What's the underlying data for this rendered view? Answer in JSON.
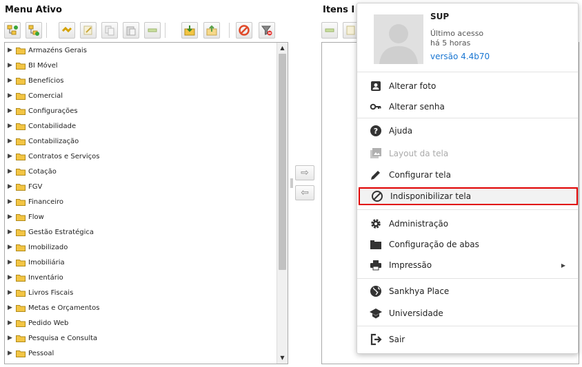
{
  "left_title": "Menu Ativo",
  "right_title": "Itens I",
  "menu_tree": [
    "Armazéns Gerais",
    "BI Móvel",
    "Benefícios",
    "Comercial",
    "Configurações",
    "Contabilidade",
    "Contabilização",
    "Contratos e Serviços",
    "Cotação",
    "FGV",
    "Financeiro",
    "Flow",
    "Gestão Estratégica",
    "Imobilizado",
    "Imobiliária",
    "Inventário",
    "Livros Fiscais",
    "Metas e Orçamentos",
    "Pedido Web",
    "Pesquisa e Consulta",
    "Pessoal"
  ],
  "user_panel": {
    "name": "SUP",
    "last_access_label": "Último acesso",
    "last_access_value": "há 5 horas",
    "version": "versão 4.4b70"
  },
  "user_menu": {
    "change_photo": "Alterar foto",
    "change_password": "Alterar senha",
    "help": "Ajuda",
    "screen_layout": "Layout da tela",
    "configure_screen": "Configurar tela",
    "disable_screen": "Indisponibilizar tela",
    "administration": "Administração",
    "tab_configuration": "Configuração de abas",
    "printing": "Impressão",
    "sankhya_place": "Sankhya Place",
    "university": "Universidade",
    "logout": "Sair"
  },
  "colors": {
    "highlight_border": "#e00000",
    "version_link": "#1976d2",
    "folder": "#f3c544"
  }
}
